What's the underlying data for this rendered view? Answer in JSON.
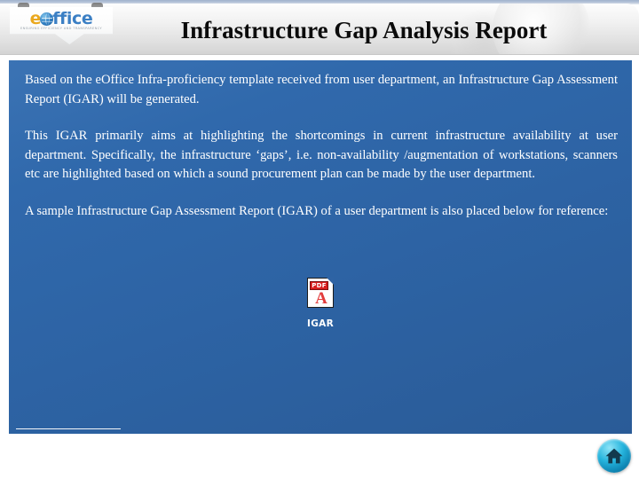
{
  "slide": {
    "title": "Infrastructure Gap Analysis Report",
    "logo": {
      "letter_e": "e",
      "letters_ffice": "ffice",
      "globe_icon": "globe-icon",
      "tagline": "ENSURING EFFICIENCY AND TRANSPARENCY"
    },
    "paragraphs": [
      "Based on the eOffice Infra-proficiency template received from user department, an Infrastructure Gap Assessment Report (IGAR) will be generated.",
      "This IGAR primarily aims at highlighting the shortcomings in current infrastructure availability at user department. Specifically, the infrastructure ‘gaps’, i.e. non-availability /augmentation of workstations, scanners etc are highlighted based on which a sound procurement plan can be made by the user department.",
      "A sample Infrastructure Gap Assessment Report (IGAR) of a user department is also placed below for reference:"
    ],
    "attachment": {
      "icon_name": "pdf-file-icon",
      "badge": "PDF",
      "label": "IGAR"
    },
    "home_button": {
      "icon_name": "home-icon",
      "label": "Home"
    },
    "colors": {
      "panel_blue": "#2D63A4",
      "panel_blue_light": "#3B73B4",
      "header_gray": "#EFEFEF",
      "title_black": "#0B0B0B",
      "body_white": "#FFFFFF",
      "logo_orange": "#EAA81E",
      "logo_blue": "#3B7FC4",
      "pdf_red": "#D81F20",
      "home_cyan": "#25B4DD"
    }
  }
}
